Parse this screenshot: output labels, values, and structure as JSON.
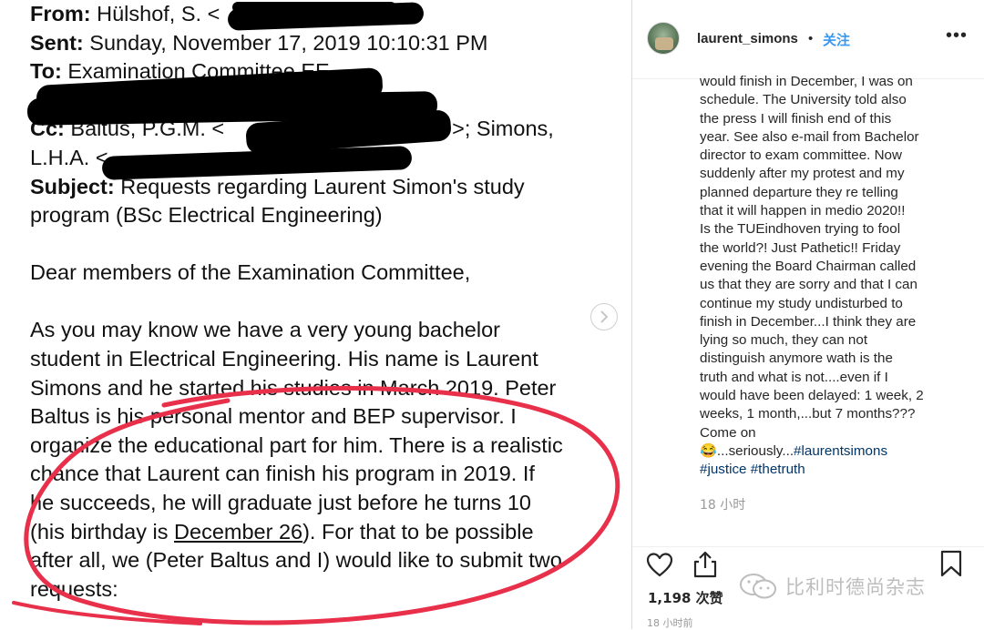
{
  "email": {
    "from_label": "From:",
    "from_value": "Hülshof, S. <",
    "sent_label": "Sent:",
    "sent_value": "Sunday, November 17, 2019 10:10:31 PM",
    "to_label": "To:",
    "to_value": "Examination Committee EE",
    "cc_label": "Cc:",
    "cc_value_a": "Baltus, P.G.M. <",
    "cc_value_b": ">; Simons,",
    "cc_value_c": "L.H.A. <",
    "subject_label": "Subject:",
    "subject_value_1": "Requests regarding Laurent Simon's study",
    "subject_value_2": "program (BSc Electrical Engineering)",
    "greeting": "Dear members of the Examination Committee,",
    "body_lines": [
      "As you may know we have a very young bachelor",
      "student in Electrical Engineering. His name is Laurent",
      "Simons and he started his studies in March 2019. Peter",
      "Baltus is his personal mentor and BEP supervisor. I",
      "organize the educational part for him. There is a realistic",
      "chance that Laurent can finish his program in 2019. If",
      "he succeeds, he will graduate just before he turns 10"
    ],
    "birthday_prefix": "(his birthday is ",
    "birthday_date": "December 26",
    "birthday_suffix": "). For that to be possible",
    "last_lines": [
      "after all, we (Peter Baltus and I) would like to submit two",
      "requests:"
    ]
  },
  "post": {
    "username": "laurent_simons",
    "separator": "•",
    "follow_label": "关注",
    "more_label": "•••",
    "caption_lines": [
      "would finish in December, I was on",
      "schedule. The University told also",
      "the press I will finish end of this",
      "year. See also e-mail from Bachelor",
      "director to exam committee. Now",
      "suddenly after my protest and my",
      "planned departure they re telling",
      "that it will happen in medio 2020!!",
      "Is the TUEindhoven trying to fool",
      "the world?! Just Pathetic!! Friday",
      "evening the Board Chairman called",
      "us that they are sorry and that I can",
      "continue my study undisturbed to",
      "finish in December...I think they are",
      "lying so much, they can not",
      "distinguish anymore wath is the",
      "truth and what is not....even if I",
      "would have been delayed: 1 week, 2",
      "weeks, 1 month,...but 7 months???",
      "Come on"
    ],
    "caption_emoji": "😂",
    "caption_tail": "...seriously...",
    "hashtags": [
      "#laurentsimons",
      "#justice",
      "#thetruth"
    ],
    "comment_time": "18 小时",
    "likes": "1,198 次赞",
    "post_time": "18 小时前"
  },
  "watermark": {
    "text": "比利时德尚杂志"
  },
  "icons": {
    "like": "heart-icon",
    "share": "share-icon",
    "save": "bookmark-icon",
    "next": "chevron-right-icon",
    "wechat": "wechat-logo-icon"
  },
  "colors": {
    "link": "#003569",
    "follow": "#3897f0",
    "annotation": "#e8304a"
  }
}
